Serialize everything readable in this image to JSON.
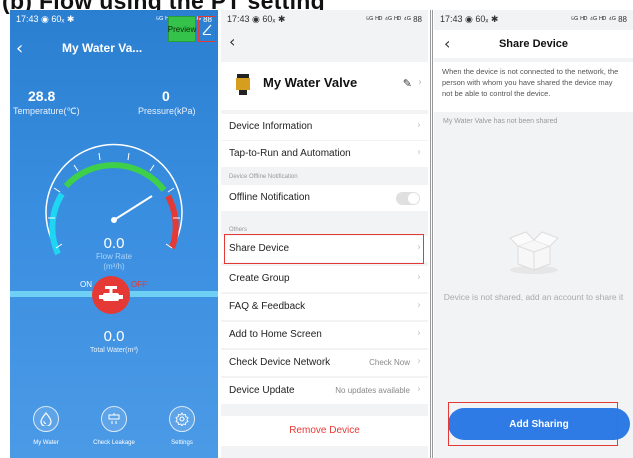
{
  "page_heading": "(b) Flow using the PT setting",
  "panel1": {
    "status_time": "17:43",
    "status_left_extra": "◉ 60ₓ ✱",
    "status_right": "⁵ᴳ ᴴᴰ ⁴ᴳ ᴴᴰ ⁴ᴳ 88",
    "back_icon": "chevron-left-icon",
    "title": "My Water Va...",
    "preview_label": "Preview",
    "edit_icon": "pencil-icon",
    "temperature_value": "28.8",
    "temperature_label": "Temperature(℃)",
    "pressure_value": "0",
    "pressure_label": "Pressure(kPa)",
    "flow_value": "0.0",
    "flow_label": "Flow Rate",
    "flow_unit": "(m³/h)",
    "on_label": "ON",
    "off_label": "OFF",
    "total_value": "0.0",
    "total_label": "Total Water(m³)",
    "nav": [
      {
        "label": "My Water",
        "icon": "water-drop-icon"
      },
      {
        "label": "Check Leakage",
        "icon": "leak-check-icon"
      },
      {
        "label": "Settings",
        "icon": "settings-gear-icon"
      }
    ],
    "colors": {
      "bg": "#3a8ee0",
      "valve": "#e53935",
      "arc_cyan": "#1fd6f2",
      "arc_green": "#3fd04a",
      "arc_red": "#e53935",
      "preview": "#35c24a"
    }
  },
  "panel2": {
    "status_time": "17:43",
    "status_left_extra": "◉ 60ₓ ✱",
    "status_right": "⁵ᴳ ᴴᴰ ⁴ᴳ ᴴᴰ ⁴ᴳ 88",
    "back_icon": "chevron-left-icon",
    "device_name": "My Water Valve",
    "device_icon": "valve-device-icon",
    "edit_icon": "pencil-icon",
    "rows_top": [
      {
        "label": "Device Information"
      },
      {
        "label": "Tap-to-Run and Automation"
      }
    ],
    "offline_section": "Device Offline Notification",
    "offline_label": "Offline Notification",
    "others_section": "Others",
    "rows_others": [
      {
        "label": "Share Device",
        "value": ""
      },
      {
        "label": "Create Group",
        "value": ""
      },
      {
        "label": "FAQ & Feedback",
        "value": ""
      },
      {
        "label": "Add to Home Screen",
        "value": ""
      },
      {
        "label": "Check Device Network",
        "value": "Check Now"
      },
      {
        "label": "Device Update",
        "value": "No updates available"
      }
    ],
    "remove_label": "Remove Device"
  },
  "panel3": {
    "status_time": "17:43",
    "status_left_extra": "◉ 60ₓ ✱",
    "status_right": "⁵ᴳ ᴴᴰ ⁴ᴳ ᴴᴰ ⁴ᴳ 88",
    "back_icon": "chevron-left-icon",
    "title": "Share Device",
    "notice": "When the device is not connected to the network, the person with whom you have shared the device may not be able to control the device.",
    "not_shared": "My Water Valve has not been shared",
    "empty_icon": "empty-box-icon",
    "empty_label": "Device is not shared, add an account to share it",
    "add_button": "Add Sharing",
    "colors": {
      "button": "#2e7be6",
      "highlight": "#e53935"
    }
  }
}
